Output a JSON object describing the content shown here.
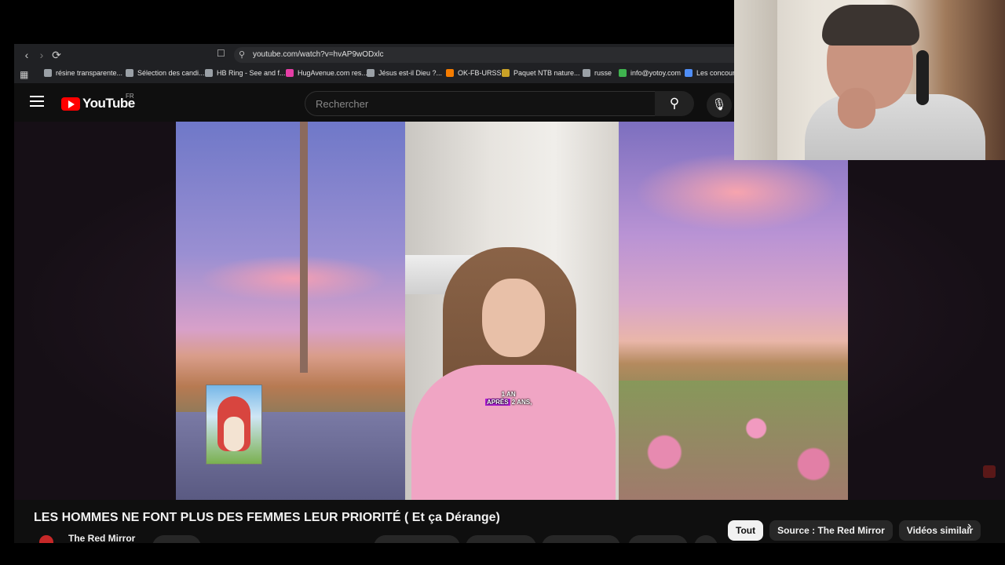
{
  "browser": {
    "url": "youtube.com/watch?v=hvAP9wODxlc",
    "bookmarks": [
      {
        "label": "résine transparente...",
        "color": "#9aa0a6"
      },
      {
        "label": "Sélection des candi...",
        "color": "#9aa0a6"
      },
      {
        "label": "HB Ring - See and f...",
        "color": "#9aa0a6"
      },
      {
        "label": "HugAvenue.com res...",
        "color": "#e53ea6"
      },
      {
        "label": "Jésus est-il Dieu ?...",
        "color": "#9aa0a6"
      },
      {
        "label": "OK-FB-URSS",
        "color": "#f57c00"
      },
      {
        "label": "Paquet NTB nature...",
        "color": "#c9a227"
      },
      {
        "label": "russe",
        "color": "#9aa0a6"
      },
      {
        "label": "info@yotoy.com",
        "color": "#3fb34f"
      },
      {
        "label": "Les concours",
        "color": "#4f8ef7"
      }
    ]
  },
  "youtube": {
    "logo_text": "YouTube",
    "country": "FR",
    "search_placeholder": "Rechercher"
  },
  "video": {
    "subtitle_line1": "1 AN",
    "subtitle_highlight": "APRÈS",
    "subtitle_line2": "2 ANS,",
    "title": "LES HOMMES NE FONT PLUS DES FEMMES LEUR PRIORITÉ ( Et ça Dérange)",
    "channel": "The Red Mirror"
  },
  "chips": [
    {
      "label": "Tout",
      "active": true
    },
    {
      "label": "Source : The Red Mirror",
      "active": false
    },
    {
      "label": "Vidéos similair",
      "active": false
    }
  ],
  "colors": {
    "youtube_red": "#ff0000",
    "subtitle_highlight": "#b01dd8",
    "background": "#0f0f0f"
  }
}
